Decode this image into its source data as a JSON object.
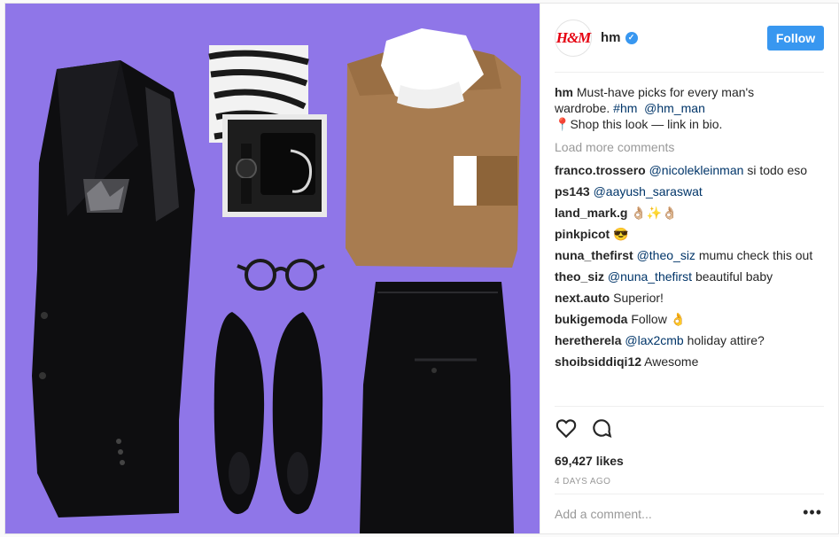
{
  "post": {
    "account": {
      "avatar_text": "H&M",
      "username": "hm",
      "verified_icon": "verified-badge-icon",
      "follow_label": "Follow"
    },
    "caption": {
      "username": "hm",
      "line1": "Must-have picks for every man's",
      "line2_prefix": "wardrobe.",
      "hashtag": "#hm",
      "mention": "@hm_man",
      "pin_icon": "📍",
      "line3": "Shop this look — link in bio."
    },
    "load_more_label": "Load more comments",
    "comments": [
      {
        "user": "franco.trossero",
        "mention": "@nicolekleinman",
        "text": "si todo eso"
      },
      {
        "user": "ps143",
        "mention": "@aayush_saraswat",
        "text": ""
      },
      {
        "user": "land_mark.g",
        "mention": "",
        "text": "👌🏼✨👌🏼"
      },
      {
        "user": "pinkpicot",
        "mention": "",
        "text": "😎"
      },
      {
        "user": "nuna_thefirst",
        "mention": "@theo_siz",
        "text": "mumu check this out"
      },
      {
        "user": "theo_siz",
        "mention": "@nuna_thefirst",
        "text": "beautiful baby"
      },
      {
        "user": "next.auto",
        "mention": "",
        "text": "Superior!"
      },
      {
        "user": "bukigemoda",
        "mention": "",
        "text": "Follow 👌"
      },
      {
        "user": "heretherela",
        "mention": "@lax2cmb",
        "text": "holiday attire?"
      },
      {
        "user": "shoibsiddiqi12",
        "mention": "",
        "text": "Awesome"
      }
    ],
    "likes": "69,427 likes",
    "time_ago": "4 DAYS AGO",
    "add_comment_placeholder": "Add a comment...",
    "more_label": "•••"
  },
  "colors": {
    "photo_background": "#8f76e8",
    "follow_button": "#3897f0",
    "link": "#003569",
    "brand_red": "#e50010"
  }
}
